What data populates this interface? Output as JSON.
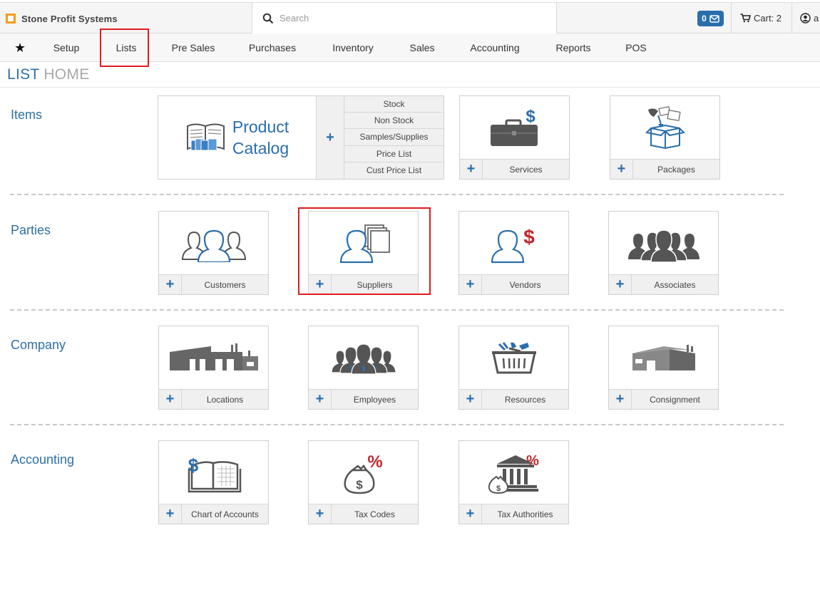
{
  "app": {
    "brand": "Stone Profit Systems"
  },
  "search": {
    "placeholder": "Search"
  },
  "header": {
    "mail_count": "0",
    "cart_label": "Cart: 2",
    "user_label": "a"
  },
  "nav": {
    "items": [
      "Setup",
      "Lists",
      "Pre Sales",
      "Purchases",
      "Inventory",
      "Sales",
      "Accounting",
      "Reports",
      "POS"
    ]
  },
  "page": {
    "title_a": "LIST",
    "title_b": "HOME"
  },
  "sections": {
    "items": {
      "label": "Items",
      "catalog": {
        "title_line1": "Product",
        "title_line2": "Catalog",
        "links": [
          "Stock",
          "Non Stock",
          "Samples/Supplies",
          "Price List",
          "Cust Price List"
        ]
      },
      "cards": [
        "Services",
        "Packages"
      ]
    },
    "parties": {
      "label": "Parties",
      "cards": [
        "Customers",
        "Suppliers",
        "Vendors",
        "Associates"
      ]
    },
    "company": {
      "label": "Company",
      "cards": [
        "Locations",
        "Employees",
        "Resources",
        "Consignment"
      ]
    },
    "accounting": {
      "label": "Accounting",
      "cards": [
        "Chart of Accounts",
        "Tax Codes",
        "Tax Authorities"
      ]
    }
  },
  "plus_symbol": "+",
  "colors": {
    "accent": "#2a6ead",
    "highlight": "#e01b1b",
    "red_icon": "#c0272d",
    "gray_icon": "#666666"
  }
}
